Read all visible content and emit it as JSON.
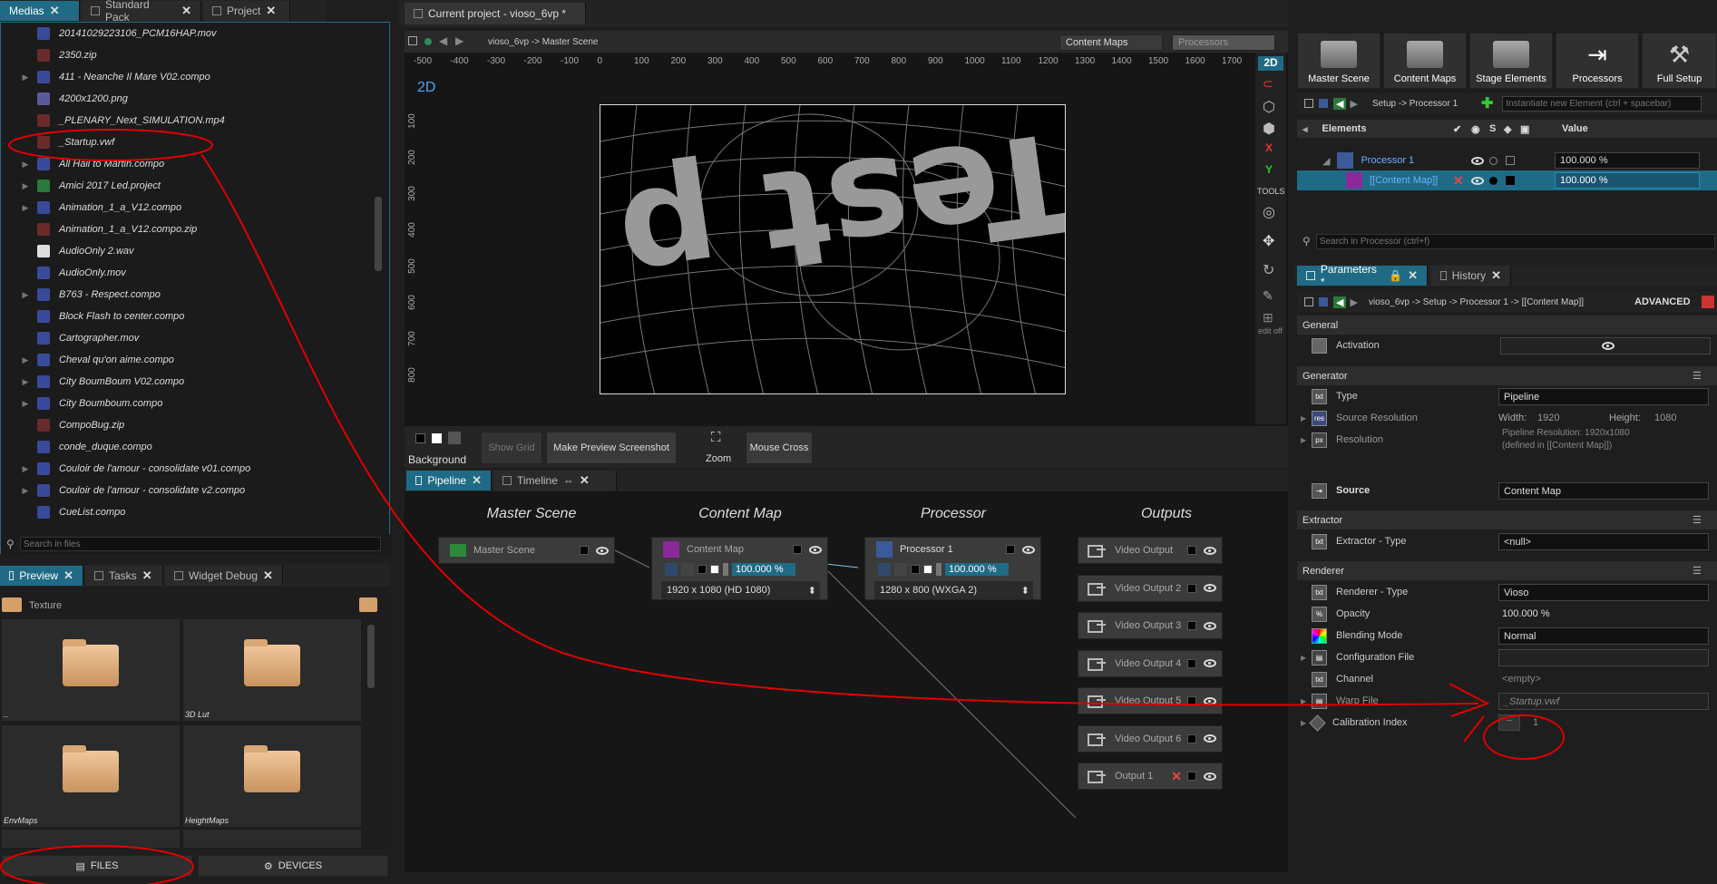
{
  "left_tabs": [
    {
      "label": "Medias"
    },
    {
      "label": "Standard Pack"
    },
    {
      "label": "Project"
    }
  ],
  "files": [
    {
      "name": "20141029223106_PCM16HAP.mov",
      "type": "mov",
      "expand": false
    },
    {
      "name": "2350.zip",
      "type": "zip",
      "expand": false
    },
    {
      "name": "411 - Neanche Il Mare V02.compo",
      "type": "compo",
      "expand": true
    },
    {
      "name": "4200x1200.png",
      "type": "png",
      "expand": false
    },
    {
      "name": "_PLENARY_Next_SIMULATION.mp4",
      "type": "zip",
      "expand": false
    },
    {
      "name": "_Startup.vwf",
      "type": "zip",
      "expand": false
    },
    {
      "name": "All Hail to Martin.compo",
      "type": "compo",
      "expand": true
    },
    {
      "name": "Amici 2017 Led.project",
      "type": "project",
      "expand": true
    },
    {
      "name": "Animation_1_a_V12.compo",
      "type": "compo",
      "expand": true
    },
    {
      "name": "Animation_1_a_V12.compo.zip",
      "type": "zip",
      "expand": false
    },
    {
      "name": "AudioOnly 2.wav",
      "type": "wav",
      "expand": false
    },
    {
      "name": "AudioOnly.mov",
      "type": "mov",
      "expand": false
    },
    {
      "name": "B763 - Respect.compo",
      "type": "compo",
      "expand": true
    },
    {
      "name": "Block Flash to center.compo",
      "type": "compo",
      "expand": false
    },
    {
      "name": "Cartographer.mov",
      "type": "mov",
      "expand": false
    },
    {
      "name": "Cheval qu'on aime.compo",
      "type": "compo",
      "expand": true
    },
    {
      "name": "City BoumBoum V02.compo",
      "type": "compo",
      "expand": true
    },
    {
      "name": "City Boumboum.compo",
      "type": "compo",
      "expand": true
    },
    {
      "name": "CompoBug.zip",
      "type": "zip",
      "expand": false
    },
    {
      "name": "conde_duque.compo",
      "type": "compo",
      "expand": false
    },
    {
      "name": "Couloir de l'amour - consolidate v01.compo",
      "type": "compo",
      "expand": true
    },
    {
      "name": "Couloir de l'amour - consolidate v2.compo",
      "type": "compo",
      "expand": true
    },
    {
      "name": "CueList.compo",
      "type": "compo",
      "expand": false
    }
  ],
  "search_files_placeholder": "Search in files",
  "preview_tabs": [
    {
      "label": "Preview"
    },
    {
      "label": "Tasks"
    },
    {
      "label": "Widget Debug"
    }
  ],
  "texture_label": "Texture",
  "thumbs": [
    {
      "label": ".."
    },
    {
      "label": "3D Lut"
    },
    {
      "label": "EnvMaps"
    },
    {
      "label": "HeightMaps"
    }
  ],
  "bottom_buttons": {
    "files": "FILES",
    "devices": "DEVICES"
  },
  "center_tab": "Current project - vioso_6vp *",
  "breadcrumb": "vioso_6vp -> Master Scene",
  "content_maps_btn": "Content Maps",
  "processors_btn": "Processors",
  "ruler_x": [
    "-500",
    "-400",
    "-300",
    "-200",
    "-100",
    "0",
    "100",
    "200",
    "300",
    "400",
    "500",
    "600",
    "700",
    "800",
    "900",
    "1000",
    "1100",
    "1200",
    "1300",
    "1400",
    "1500",
    "1600",
    "1700"
  ],
  "ruler_y": [
    "100",
    "200",
    "300",
    "400",
    "500",
    "600",
    "700",
    "800"
  ],
  "mode_2d": "2D",
  "side_tools": {
    "twoD": "2D",
    "x": "X",
    "y": "Y",
    "tools": "TOOLS",
    "edit_off": "edit off"
  },
  "preview_text": "Test p",
  "bottom_bar": {
    "background": "Background",
    "show_grid": "Show Grid",
    "screenshot": "Make Preview Screenshot",
    "zoom": "Zoom",
    "mouse_cross": "Mouse Cross"
  },
  "pipeline_tabs": [
    {
      "label": "Pipeline"
    },
    {
      "label": "Timeline"
    }
  ],
  "pipeline_headers": [
    "Master Scene",
    "Content Map",
    "Processor",
    "Outputs"
  ],
  "nodes": {
    "master_scene": "Master Scene",
    "content_map": "Content Map",
    "content_map_pct": "100.000 %",
    "content_map_res": "1920 x 1080    (HD 1080)",
    "processor": "Processor 1",
    "processor_pct": "100.000 %",
    "processor_res": "1280 x 800     (WXGA 2)"
  },
  "outputs": [
    "Video Output",
    "Video Output 2",
    "Video Output 3",
    "Video Output 4",
    "Video Output 5",
    "Video Output 6",
    "Output 1"
  ],
  "top_tools": [
    {
      "label": "Master Scene"
    },
    {
      "label": "Content Maps"
    },
    {
      "label": "Stage Elements"
    },
    {
      "label": "Processors"
    },
    {
      "label": "Full Setup"
    }
  ],
  "setup_path": "Setup -> Processor 1",
  "instantiate_placeholder": "Instantiate new Element (ctrl + spacebar)",
  "elements_header": {
    "elements": "Elements",
    "s": "S",
    "value": "Value"
  },
  "elements": [
    {
      "name": "Processor 1",
      "value": "100.000 %"
    },
    {
      "name": "[[Content Map]]",
      "value": "100.000 %"
    }
  ],
  "search_processor_placeholder": "Search in Processor (ctrl+f)",
  "param_tabs": [
    {
      "label": "Parameters *"
    },
    {
      "label": "History"
    }
  ],
  "param_path": "vioso_6vp -> Setup -> Processor 1 -> [[Content Map]]",
  "advanced": "ADVANCED",
  "sections": {
    "general": "General",
    "generator": "Generator",
    "extractor": "Extractor",
    "renderer": "Renderer"
  },
  "params": {
    "activation": "Activation",
    "type": "Type",
    "type_val": "Pipeline",
    "source_res": "Source Resolution",
    "width_label": "Width:",
    "width_val": "1920",
    "height_label": "Height:",
    "height_val": "1080",
    "resolution": "Resolution",
    "pipeline_res": "Pipeline Resolution:      1920x1080",
    "defined_in": "(defined in [[Content Map]])",
    "source": "Source",
    "source_val": "Content Map",
    "extractor_type": "Extractor - Type",
    "extractor_val": "<null>",
    "renderer_type": "Renderer - Type",
    "renderer_val": "Vioso",
    "opacity": "Opacity",
    "opacity_val": "100.000 %",
    "blending": "Blending Mode",
    "blending_val": "Normal",
    "config_file": "Configuration File",
    "channel": "Channel",
    "channel_val": "<empty>",
    "warp_file": "Warp File",
    "warp_val": "_Startup.vwf",
    "calib": "Calibration Index",
    "calib_val": "1"
  }
}
